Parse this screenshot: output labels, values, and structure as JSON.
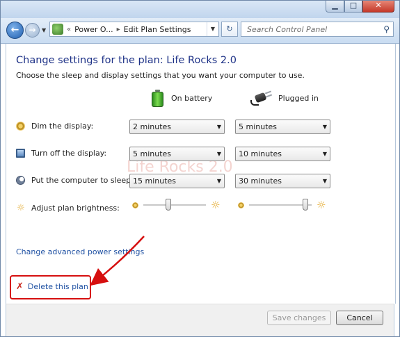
{
  "window": {
    "buttons": {
      "minimize": "▁",
      "maximize": "□",
      "close": "✕"
    }
  },
  "address": {
    "breadcrumb": [
      "Power O...",
      "Edit Plan Settings"
    ],
    "breadcrumb_prefix": "«",
    "search_placeholder": "Search Control Panel"
  },
  "plan": {
    "title": "Change settings for the plan: Life Rocks 2.0",
    "subtitle": "Choose the sleep and display settings that you want your computer to use."
  },
  "columns": {
    "battery": "On battery",
    "plugged": "Plugged in"
  },
  "settings": [
    {
      "label": "Dim the display:",
      "battery": "2 minutes",
      "plugged": "5 minutes",
      "icon": "dim-display-icon"
    },
    {
      "label": "Turn off the display:",
      "battery": "5 minutes",
      "plugged": "10 minutes",
      "icon": "monitor-clock-icon"
    },
    {
      "label": "Put the computer to sleep:",
      "battery": "15 minutes",
      "plugged": "30 minutes",
      "icon": "moon-icon"
    }
  ],
  "brightness": {
    "label": "Adjust plan brightness:",
    "battery_level_percent": 40,
    "plugged_level_percent": 90
  },
  "watermark": "Life Rocks 2.0",
  "links": {
    "advanced": "Change advanced power settings",
    "delete": "Delete this plan"
  },
  "footer": {
    "save": "Save changes",
    "cancel": "Cancel"
  },
  "colors": {
    "title_blue": "#1e3287",
    "link_blue": "#1e50a2",
    "highlight_red": "#d60f0f"
  }
}
